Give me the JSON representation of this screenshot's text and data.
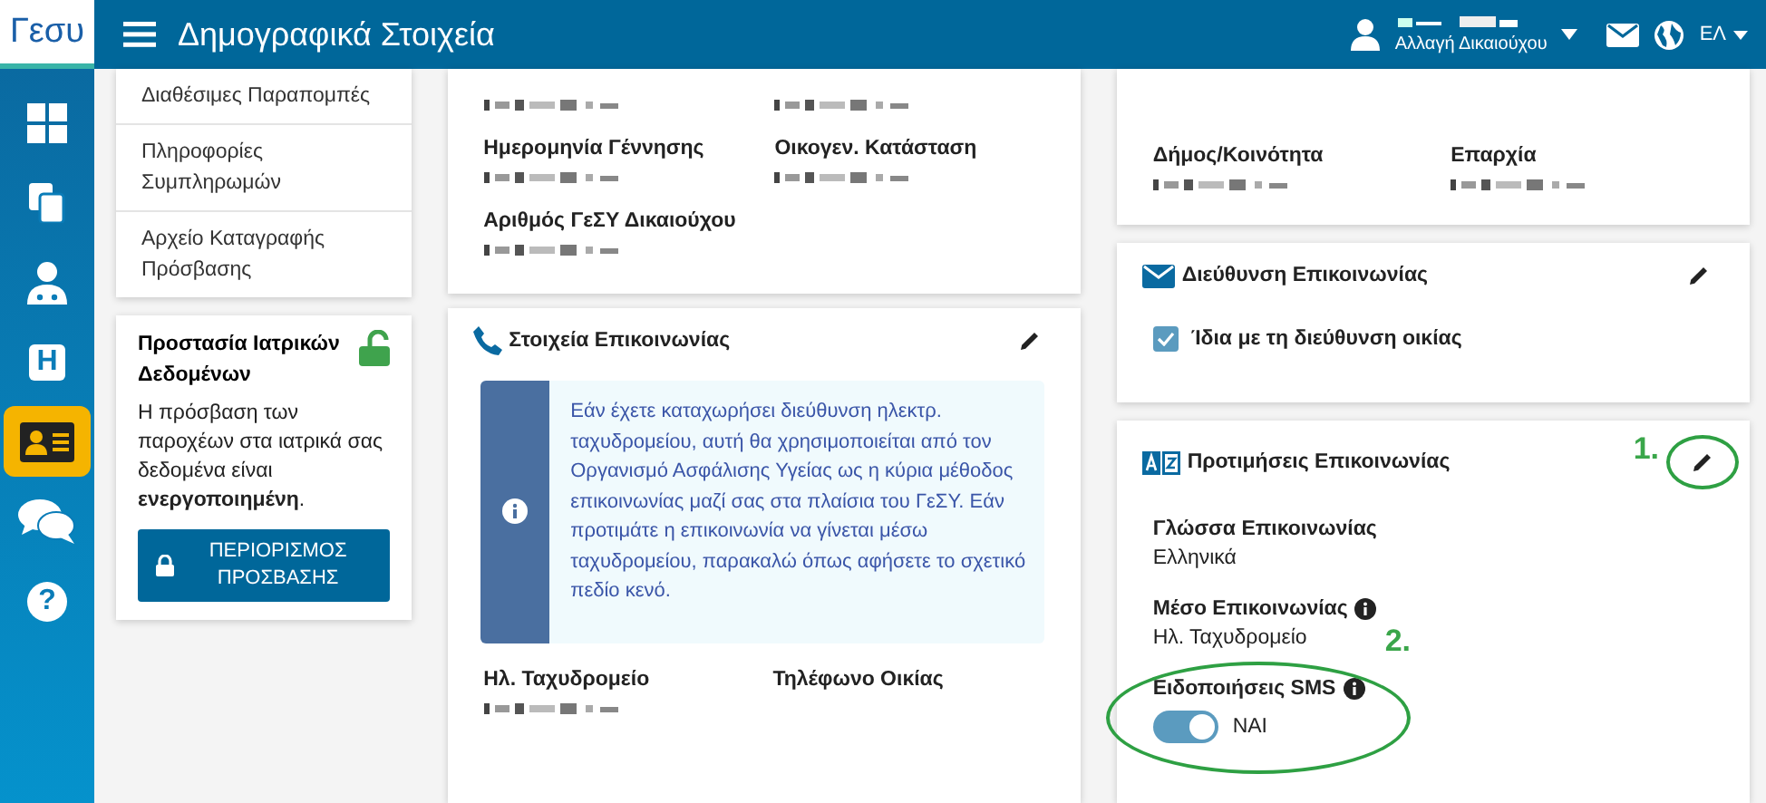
{
  "header": {
    "logo": "Γεσυ",
    "title": "Δημογραφικά Στοιχεία",
    "user": {
      "name_redacted": true,
      "subtitle": "Αλλαγή Δικαιούχου"
    },
    "language": "ΕΛ"
  },
  "rail": [
    {
      "kind": "grid",
      "selected": false
    },
    {
      "kind": "copy",
      "selected": false
    },
    {
      "kind": "doctor",
      "selected": false
    },
    {
      "kind": "letter",
      "glyph": "H",
      "selected": false
    },
    {
      "kind": "idcard",
      "selected": true
    },
    {
      "kind": "chat",
      "selected": false
    },
    {
      "kind": "letter",
      "glyph": "?",
      "round": true,
      "selected": false
    }
  ],
  "menu": [
    "Διαθέσιμες Παραπομπές",
    "Πληροφορίες Συμπληρωμών",
    "Αρχείο Καταγραφής Πρόσβασης"
  ],
  "protection": {
    "title": "Προστασία Ιατρικών Δεδομένων",
    "locked": false,
    "text": "Η πρόσβαση των παροχέων στα ιατρικά σας δεδομένα είναι **ενεργοποιημένη**.",
    "button": "ΠΕΡΙΟΡΙΣΜΟΣ ΠΡΟΣΒΑΣΗΣ"
  },
  "personal": {
    "fields": [
      {
        "value_redacted": true
      },
      {
        "value_redacted": true
      },
      {
        "label": "Ημερομηνία Γέννησης",
        "value_redacted": true
      },
      {
        "label": "Οικογεν. Κατάσταση",
        "value_redacted": true
      },
      {
        "label": "Αριθμός ΓεΣΥ Δικαιούχου",
        "value_redacted": true
      }
    ]
  },
  "contact": {
    "title": "Στοιχεία Επικοινωνίας",
    "info": "Εάν έχετε καταχωρήσει διεύθυνση ηλεκτρ. ταχυδρομείου, αυτή θα χρησιμοποιείται από τον Οργανισμό Ασφάλισης Υγείας ως η κύρια μέθοδος επικοινωνίας μαζί σας στα πλαίσια του ΓεΣΥ. Εάν προτιμάτε η επικοινωνία να γίνεται μέσω ταχυδρομείου, παρακαλώ όπως αφήσετε το σχετικό πεδίο κενό.",
    "fields": [
      {
        "label": "Ηλ. Ταχυδρομείο",
        "value_redacted": true
      },
      {
        "label": "Τηλέφωνο Οικίας",
        "value_redacted": false
      }
    ]
  },
  "address": {
    "fields": [
      {
        "label": "Δήμος/Κοινότητα",
        "value_redacted": true
      },
      {
        "label": "Επαρχία",
        "value_redacted": true
      }
    ]
  },
  "postal": {
    "title": "Διεύθυνση Επικοινωνίας",
    "same_as_home": {
      "label": "Ίδια με τη διεύθυνση οικίας",
      "checked": true
    }
  },
  "preferences": {
    "title": "Προτιμήσεις Επικοινωνίας",
    "fields": [
      {
        "kind": "text",
        "label": "Γλώσσα Επικοινωνίας",
        "value": "Ελληνικά",
        "info": false
      },
      {
        "kind": "text",
        "label": "Μέσο Επικοινωνίας",
        "value": "Ηλ. Ταχυδρομείο",
        "info": true
      },
      {
        "kind": "toggle",
        "label": "Ειδοποιήσεις SMS",
        "value": "ΝΑΙ",
        "info": true,
        "on": true
      }
    ]
  },
  "annotations": [
    "1.",
    "2."
  ]
}
